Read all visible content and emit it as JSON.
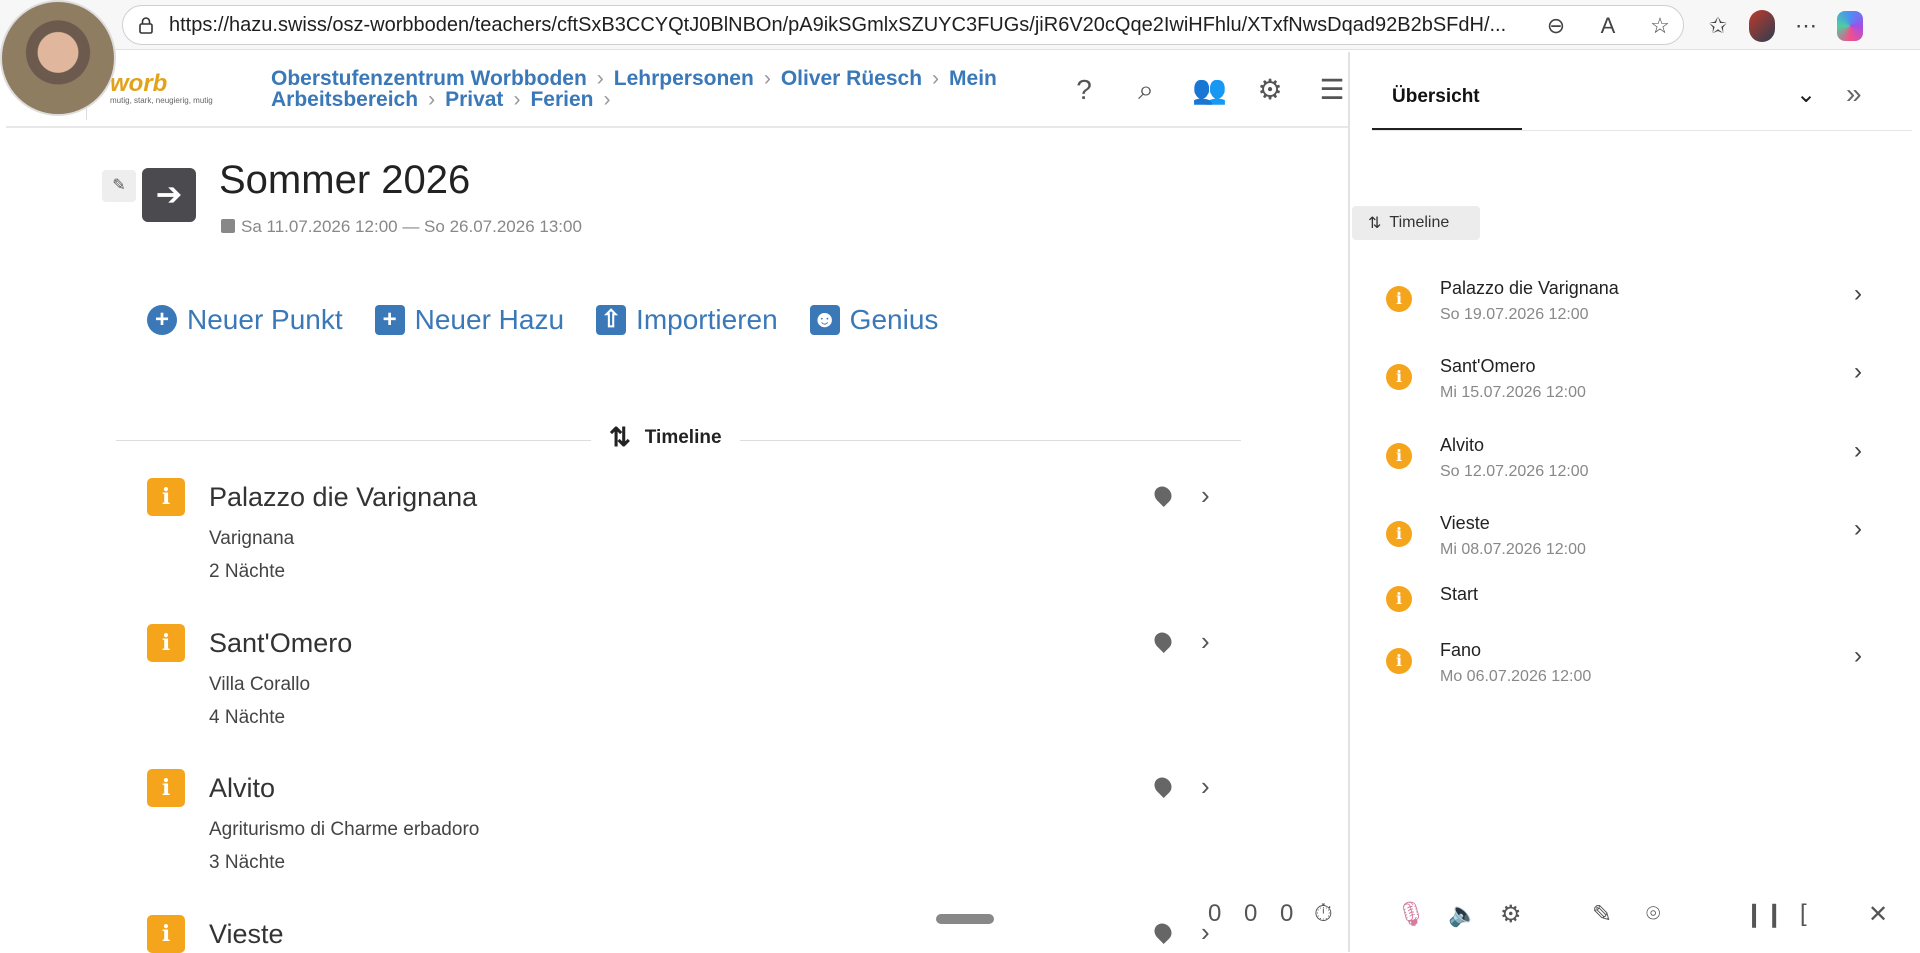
{
  "browser": {
    "url": "https://hazu.swiss/osz-worbboden/teachers/cftSxB3CCYQtJ0BlNBOn/pA9ikSGmlxSZUYC3FUGs/jiR6V20cQqe2IwiHFhlu/XTxfNwsDqad92B2bSFdH/..."
  },
  "logo": {
    "word": "worb",
    "tagline": "mutig, stark, neugierig, mutig"
  },
  "breadcrumb": {
    "items": [
      "Oberstufenzentrum Worbboden",
      "Lehrpersonen",
      "Oliver Rüesch",
      "Mein Arbeitsbereich",
      "Privat",
      "Ferien"
    ]
  },
  "page": {
    "title": "Sommer 2026",
    "date_range": "Sa 11.07.2026 12:00 — So 26.07.2026 13:00"
  },
  "actions": {
    "new_point": "Neuer Punkt",
    "new_hazu": "Neuer Hazu",
    "import": "Importieren",
    "genius": "Genius"
  },
  "timeline": {
    "label": "Timeline"
  },
  "items": [
    {
      "name": "Palazzo die Varignana",
      "sub": "Varignana",
      "nights": "2 Nächte"
    },
    {
      "name": "Sant'Omero",
      "sub": "Villa Corallo",
      "nights": "4 Nächte"
    },
    {
      "name": "Alvito",
      "sub": "Agriturismo di Charme erbadoro",
      "nights": "3 Nächte"
    },
    {
      "name": "Vieste",
      "sub": "",
      "nights": ""
    }
  ],
  "panel": {
    "tab": "Übersicht",
    "timeline_label": "Timeline",
    "items": [
      {
        "name": "Palazzo die Varignana",
        "date": "So 19.07.2026 12:00"
      },
      {
        "name": "Sant'Omero",
        "date": "Mi 15.07.2026 12:00"
      },
      {
        "name": "Alvito",
        "date": "So 12.07.2026 12:00"
      },
      {
        "name": "Vieste",
        "date": "Mi 08.07.2026 12:00"
      },
      {
        "name": "Start",
        "date": ""
      },
      {
        "name": "Fano",
        "date": "Mo 06.07.2026 12:00"
      }
    ]
  },
  "recorder": {
    "counter_a": "0",
    "counter_b": "0",
    "counter_c": "0"
  },
  "colors": {
    "accent": "#3a78b8",
    "info_badge": "#f4a51c",
    "title": "#222222"
  }
}
